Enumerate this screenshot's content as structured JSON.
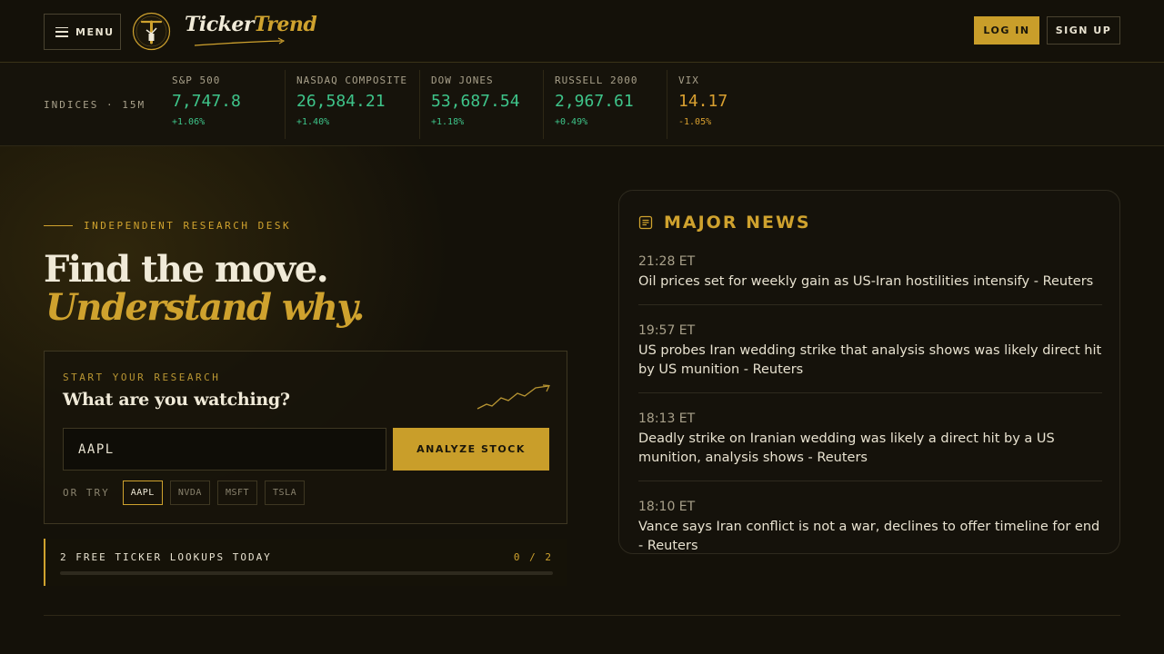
{
  "header": {
    "menu_label": "MENU",
    "logo_part1": "Ticker",
    "logo_part2": "Trend",
    "login_label": "LOG IN",
    "signup_label": "SIGN UP"
  },
  "indices": {
    "label": "INDICES · 15M",
    "items": [
      {
        "name": "S&P 500",
        "value": "7,747.8",
        "change": "+1.06%",
        "direction": "up"
      },
      {
        "name": "NASDAQ COMPOSITE",
        "value": "26,584.21",
        "change": "+1.40%",
        "direction": "up"
      },
      {
        "name": "DOW JONES",
        "value": "53,687.54",
        "change": "+1.18%",
        "direction": "up"
      },
      {
        "name": "RUSSELL 2000",
        "value": "2,967.61",
        "change": "+0.49%",
        "direction": "up"
      },
      {
        "name": "VIX",
        "value": "14.17",
        "change": "-1.05%",
        "direction": "down"
      }
    ]
  },
  "hero": {
    "eyebrow": "INDEPENDENT RESEARCH DESK",
    "headline_1": "Find the move.",
    "headline_2": "Understand why."
  },
  "research": {
    "kicker": "START YOUR RESEARCH",
    "question": "What are you watching?",
    "input_value": "AAPL",
    "analyze_label": "ANALYZE STOCK",
    "try_label": "OR TRY",
    "suggestions": [
      "AAPL",
      "NVDA",
      "MSFT",
      "TSLA"
    ],
    "active_suggestion": "AAPL"
  },
  "lookups": {
    "label": "2 FREE TICKER LOOKUPS TODAY",
    "count": "0 / 2",
    "progress": 0
  },
  "news": {
    "title": "MAJOR NEWS",
    "items": [
      {
        "time": "21:28 ET",
        "headline": "Oil prices set for weekly gain as US-Iran hostilities intensify - Reuters"
      },
      {
        "time": "19:57 ET",
        "headline": "US probes Iran wedding strike that analysis shows was likely direct hit by US munition - Reuters"
      },
      {
        "time": "18:13 ET",
        "headline": "Deadly strike on Iranian wedding was likely a direct hit by a US munition, analysis shows - Reuters"
      },
      {
        "time": "18:10 ET",
        "headline": "Vance says Iran conflict is not a war, declines to offer timeline for end - Reuters"
      }
    ]
  },
  "colors": {
    "accent": "#cfa22e",
    "up": "#3ec48a",
    "down": "#d9a030",
    "background": "#141109"
  }
}
